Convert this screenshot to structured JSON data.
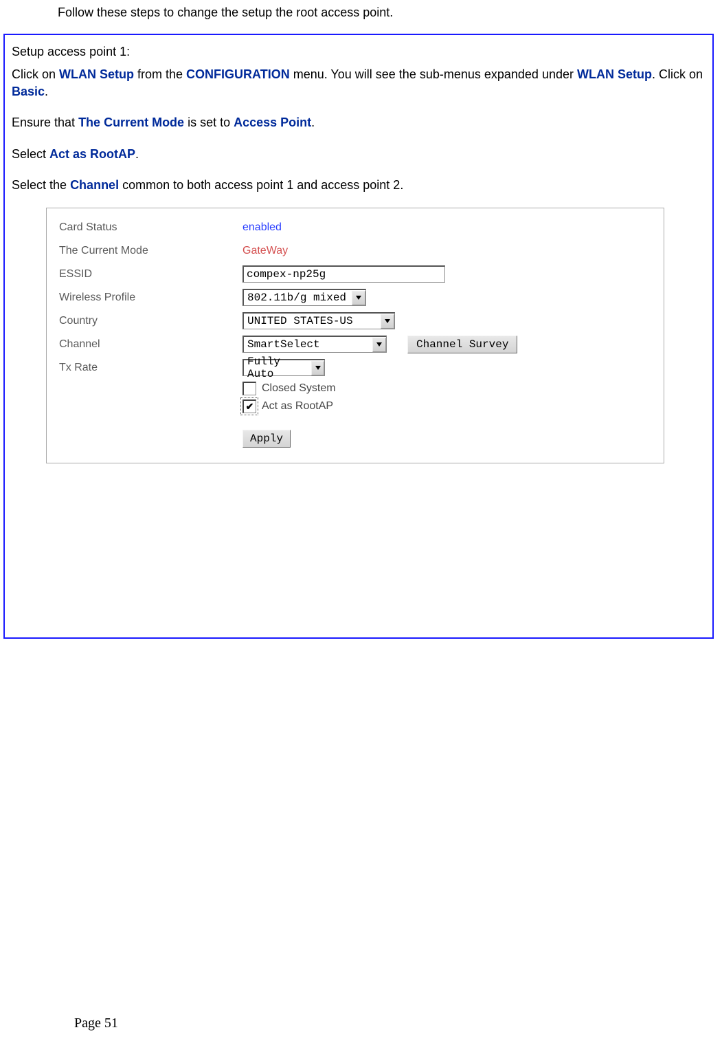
{
  "intro": "Follow these steps to change the setup the root access point.",
  "step_heading": "Setup access point 1:",
  "para1": {
    "t1": "Click on ",
    "b1": "WLAN Setup",
    "t2": " from the ",
    "b2": "CONFIGURATION",
    "t3": " menu. You will see the sub-menus expanded under ",
    "b3": "WLAN Setup",
    "t4": ". Click on ",
    "b4": "Basic",
    "t5": "."
  },
  "para2": {
    "t1": "Ensure that ",
    "b1": "The Current Mode",
    "t2": " is set to ",
    "b2": "Access Point",
    "t3": "."
  },
  "para3": {
    "t1": "Select ",
    "b1": "Act as RootAP",
    "t2": "."
  },
  "para4": {
    "t1": "Select the ",
    "b1": "Channel",
    "t2": " common to both access point 1 and access point 2."
  },
  "form": {
    "labels": {
      "card_status": "Card Status",
      "current_mode": "The Current Mode",
      "essid": "ESSID",
      "wireless_profile": "Wireless Profile",
      "country": "Country",
      "channel": "Channel",
      "tx_rate": "Tx Rate"
    },
    "values": {
      "card_status": "enabled",
      "current_mode": "GateWay",
      "essid": "compex-np25g",
      "wireless_profile": "802.11b/g mixed",
      "country": "UNITED STATES-US",
      "channel": "SmartSelect",
      "tx_rate": "Fully Auto"
    },
    "channel_survey_btn": "Channel Survey",
    "checkboxes": {
      "closed_system": "Closed System",
      "act_as_rootap": "Act as RootAP"
    },
    "apply_btn": "Apply"
  },
  "footer": "Page 51"
}
